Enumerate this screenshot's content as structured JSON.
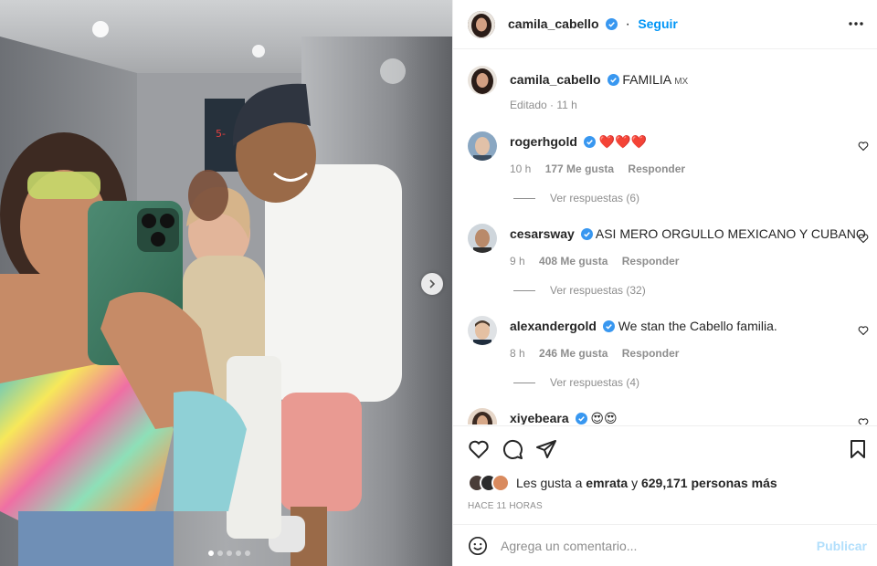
{
  "post": {
    "author": "camila_cabello",
    "follow_label": "Seguir",
    "caption_text": "FAMILIA",
    "caption_flag": "MX",
    "caption_meta": "Editado · 11 h"
  },
  "comments": [
    {
      "user": "rogerhgold",
      "text": "❤️❤️❤️",
      "time": "10 h",
      "likes": "177 Me gusta",
      "reply": "Responder",
      "view_replies": "Ver respuestas (6)"
    },
    {
      "user": "cesarsway",
      "text": "ASI MERO ORGULLO MEXICANO Y CUBANO",
      "time": "9 h",
      "likes": "408 Me gusta",
      "reply": "Responder",
      "view_replies": "Ver respuestas (32)"
    },
    {
      "user": "alexandergold",
      "text": "We stan the Cabello familia.",
      "time": "8 h",
      "likes": "246 Me gusta",
      "reply": "Responder",
      "view_replies": "Ver respuestas (4)"
    },
    {
      "user": "xiyebeara",
      "text": "😍😍"
    }
  ],
  "likes": {
    "prefix": "Les gusta a",
    "first_user": "emrata",
    "joiner": "y",
    "others": "629,171 personas más"
  },
  "time_ago": "HACE 11 HORAS",
  "add_comment": {
    "placeholder": "Agrega un comentario...",
    "publish_label": "Publicar"
  },
  "carousel": {
    "total_slides": 5,
    "active_slide": 1
  },
  "colors": {
    "accent": "#0095f6",
    "verified": "#3897f0",
    "heart": "#ed4956"
  },
  "icons": [
    "more-icon",
    "verified-icon",
    "heart-icon",
    "comment-icon",
    "share-icon",
    "bookmark-icon",
    "emoji-icon",
    "chevron-right-icon"
  ]
}
